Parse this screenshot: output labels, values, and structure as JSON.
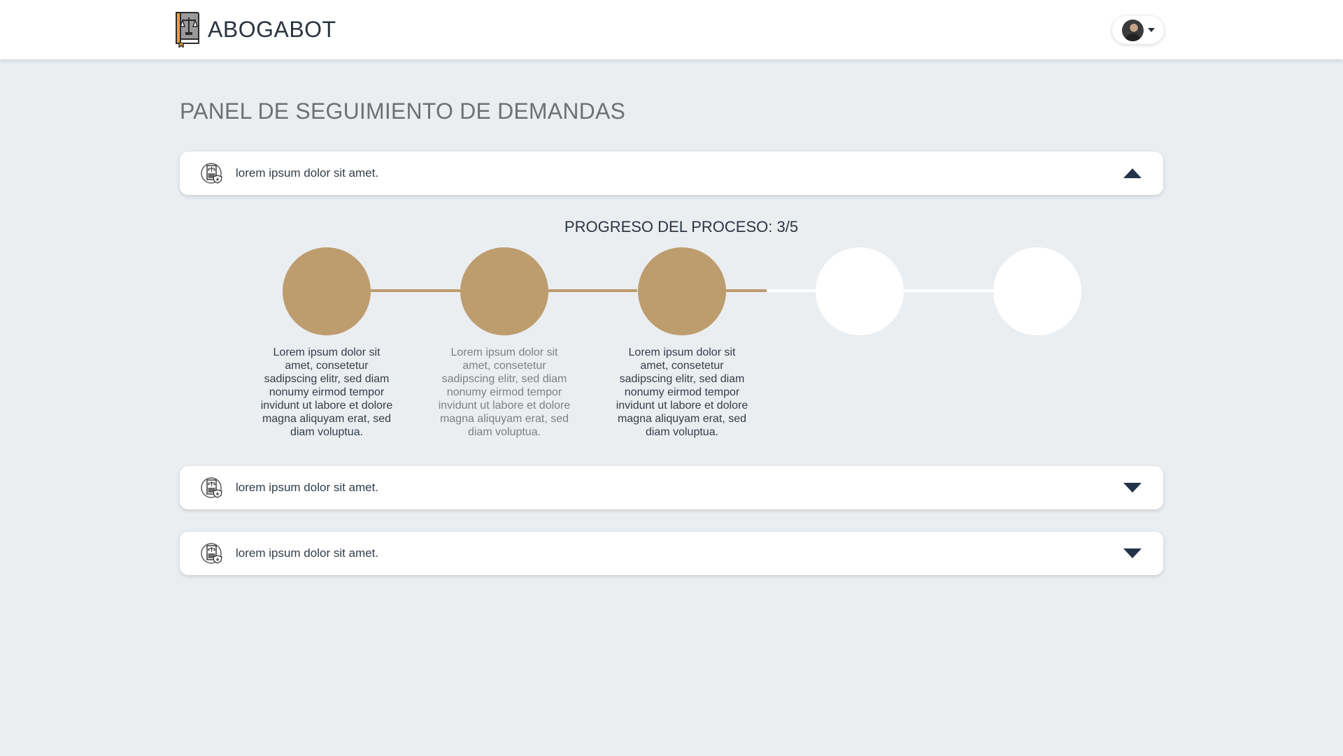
{
  "header": {
    "brand_name": "ABOGABOT",
    "logo_icon": "law-book-scales-icon",
    "user_avatar": "user-avatar",
    "user_menu_icon": "caret-down-icon"
  },
  "page": {
    "title": "PANEL DE SEGUIMIENTO DE DEMANDAS"
  },
  "cases": [
    {
      "label": "lorem ipsum dolor sit amet.",
      "icon": "legal-document-icon",
      "expanded": true
    },
    {
      "label": "lorem ipsum dolor sit amet.",
      "icon": "legal-document-icon",
      "expanded": false
    },
    {
      "label": "lorem ipsum dolor sit amet.",
      "icon": "legal-document-icon",
      "expanded": false
    }
  ],
  "progress": {
    "title": "PROGRESO DEL PROCESO: 3/5",
    "completed": 3,
    "total": 5,
    "steps": [
      {
        "text": "Lorem ipsum dolor sit amet, consetetur sadipscing elitr, sed diam nonumy eirmod tempor invidunt ut labore et dolore magna aliquyam erat, sed diam voluptua.",
        "status": "done"
      },
      {
        "text": "Lorem ipsum dolor sit amet, consetetur sadipscing elitr, sed diam nonumy eirmod tempor invidunt ut labore et dolore magna aliquyam erat, sed diam voluptua.",
        "status": "done"
      },
      {
        "text": "Lorem ipsum dolor sit amet, consetetur sadipscing elitr, sed diam nonumy eirmod tempor invidunt ut labore et dolore magna aliquyam erat, sed diam voluptua.",
        "status": "done"
      },
      {
        "text": "",
        "status": "pending"
      },
      {
        "text": "",
        "status": "pending"
      }
    ]
  },
  "colors": {
    "background": "#eaeef1",
    "accent_done": "#bd9c6e",
    "pending": "#ffffff",
    "toggle": "#23334a"
  }
}
